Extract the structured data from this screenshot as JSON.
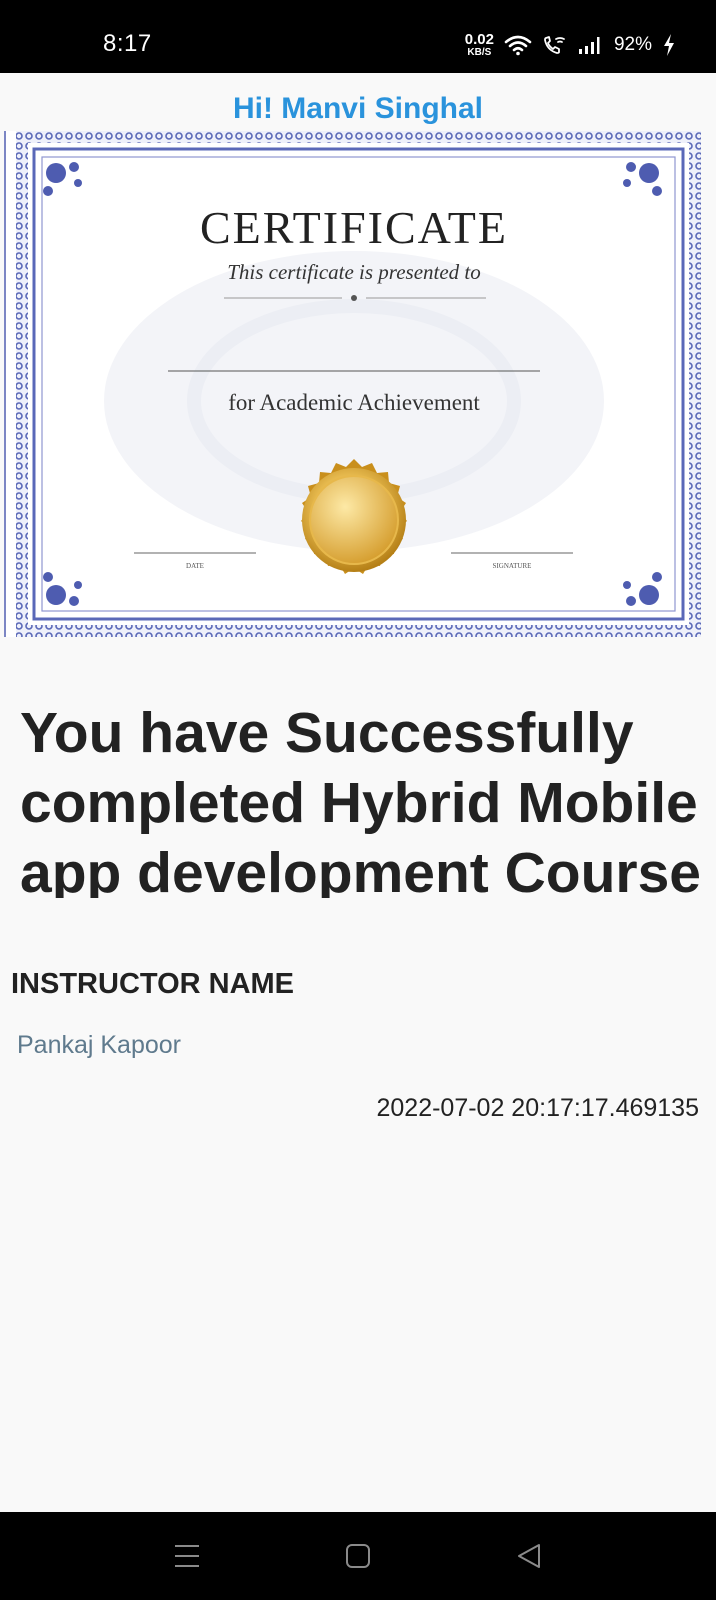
{
  "status_bar": {
    "time": "8:17",
    "net_speed_value": "0.02",
    "net_speed_unit": "KB/S",
    "battery": "92%",
    "icons": [
      "wifi-icon",
      "wifi-calling-icon",
      "signal-icon",
      "charging-icon"
    ]
  },
  "greeting": "Hi! Manvi Singhal",
  "certificate": {
    "title": "CERTIFICATE",
    "subtitle": "This certificate is presented to",
    "purpose": "for Academic Achievement",
    "date_label": "DATE",
    "signature_label": "SIGNATURE",
    "border_color": "#5a68b8",
    "seal_color": "#d9a32a"
  },
  "headline": "You have Successfully completed Hybrid Mobile app development Course",
  "instructor": {
    "heading": "INSTRUCTOR NAME",
    "name": "Pankaj Kapoor"
  },
  "timestamp": "2022-07-02 20:17:17.469135",
  "navigation": {
    "icons": [
      "menu-icon",
      "home-icon",
      "back-icon"
    ]
  },
  "colors": {
    "accent": "#2a93dc",
    "instructor_name": "#5f7a8d",
    "text": "#222222",
    "background": "#f9f9f9"
  }
}
